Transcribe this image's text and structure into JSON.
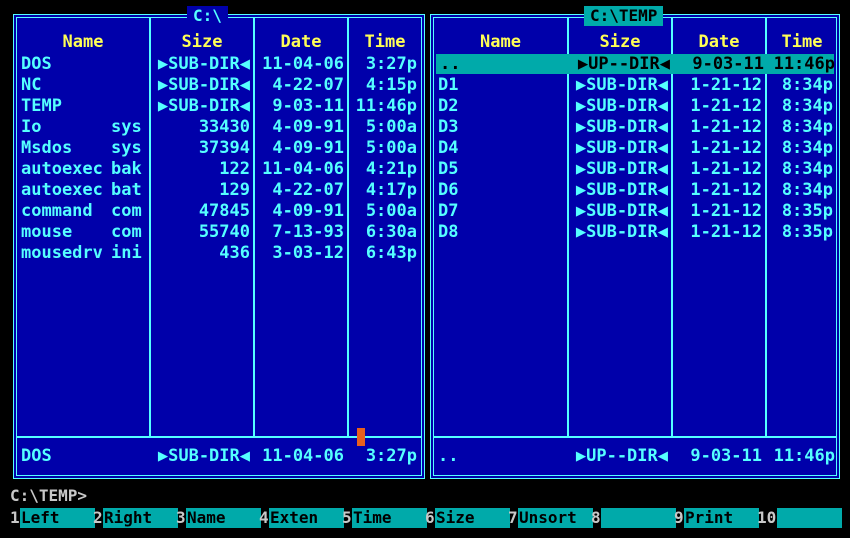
{
  "left_panel": {
    "title": "C:\\",
    "headers": {
      "name": "Name",
      "size": "Size",
      "date": "Date",
      "time": "Time"
    },
    "rows": [
      {
        "name": "DOS",
        "ext": "",
        "size": "▶SUB-DIR◀",
        "date": "11-04-06",
        "time": "3:27p"
      },
      {
        "name": "NC",
        "ext": "",
        "size": "▶SUB-DIR◀",
        "date": "4-22-07",
        "time": "4:15p"
      },
      {
        "name": "TEMP",
        "ext": "",
        "size": "▶SUB-DIR◀",
        "date": "9-03-11",
        "time": "11:46p"
      },
      {
        "name": "Io",
        "ext": "sys",
        "size": "33430",
        "date": "4-09-91",
        "time": "5:00a"
      },
      {
        "name": "Msdos",
        "ext": "sys",
        "size": "37394",
        "date": "4-09-91",
        "time": "5:00a"
      },
      {
        "name": "autoexec",
        "ext": "bak",
        "size": "122",
        "date": "11-04-06",
        "time": "4:21p"
      },
      {
        "name": "autoexec",
        "ext": "bat",
        "size": "129",
        "date": "4-22-07",
        "time": "4:17p"
      },
      {
        "name": "command",
        "ext": "com",
        "size": "47845",
        "date": "4-09-91",
        "time": "5:00a"
      },
      {
        "name": "mouse",
        "ext": "com",
        "size": "55740",
        "date": "7-13-93",
        "time": "6:30a"
      },
      {
        "name": "mousedrv",
        "ext": "ini",
        "size": "436",
        "date": "3-03-12",
        "time": "6:43p"
      }
    ],
    "status": {
      "name": "DOS",
      "size": "▶SUB-DIR◀",
      "date": "11-04-06",
      "time": "3:27p"
    }
  },
  "right_panel": {
    "title": "C:\\TEMP",
    "headers": {
      "name": "Name",
      "size": "Size",
      "date": "Date",
      "time": "Time"
    },
    "rows": [
      {
        "name": "..",
        "ext": "",
        "size": "▶UP--DIR◀",
        "date": "9-03-11",
        "time": "11:46p",
        "selected": true
      },
      {
        "name": "D1",
        "ext": "",
        "size": "▶SUB-DIR◀",
        "date": "1-21-12",
        "time": "8:34p"
      },
      {
        "name": "D2",
        "ext": "",
        "size": "▶SUB-DIR◀",
        "date": "1-21-12",
        "time": "8:34p"
      },
      {
        "name": "D3",
        "ext": "",
        "size": "▶SUB-DIR◀",
        "date": "1-21-12",
        "time": "8:34p"
      },
      {
        "name": "D4",
        "ext": "",
        "size": "▶SUB-DIR◀",
        "date": "1-21-12",
        "time": "8:34p"
      },
      {
        "name": "D5",
        "ext": "",
        "size": "▶SUB-DIR◀",
        "date": "1-21-12",
        "time": "8:34p"
      },
      {
        "name": "D6",
        "ext": "",
        "size": "▶SUB-DIR◀",
        "date": "1-21-12",
        "time": "8:34p"
      },
      {
        "name": "D7",
        "ext": "",
        "size": "▶SUB-DIR◀",
        "date": "1-21-12",
        "time": "8:35p"
      },
      {
        "name": "D8",
        "ext": "",
        "size": "▶SUB-DIR◀",
        "date": "1-21-12",
        "time": "8:35p"
      }
    ],
    "status": {
      "name": "..",
      "size": "▶UP--DIR◀",
      "date": "9-03-11",
      "time": "11:46p"
    }
  },
  "command_line": {
    "prompt": "C:\\TEMP>"
  },
  "function_keys": [
    {
      "num": "1",
      "label": "Left"
    },
    {
      "num": "2",
      "label": "Right"
    },
    {
      "num": "3",
      "label": "Name"
    },
    {
      "num": "4",
      "label": "Exten"
    },
    {
      "num": "5",
      "label": "Time"
    },
    {
      "num": "6",
      "label": "Size"
    },
    {
      "num": "7",
      "label": "Unsort"
    },
    {
      "num": "8",
      "label": ""
    },
    {
      "num": "9",
      "label": "Print"
    },
    {
      "num": "10",
      "label": ""
    }
  ],
  "colors": {
    "panel_bg": "#0000aa",
    "text": "#55ffff",
    "header": "#ffff55",
    "selection": "#00aaaa"
  }
}
